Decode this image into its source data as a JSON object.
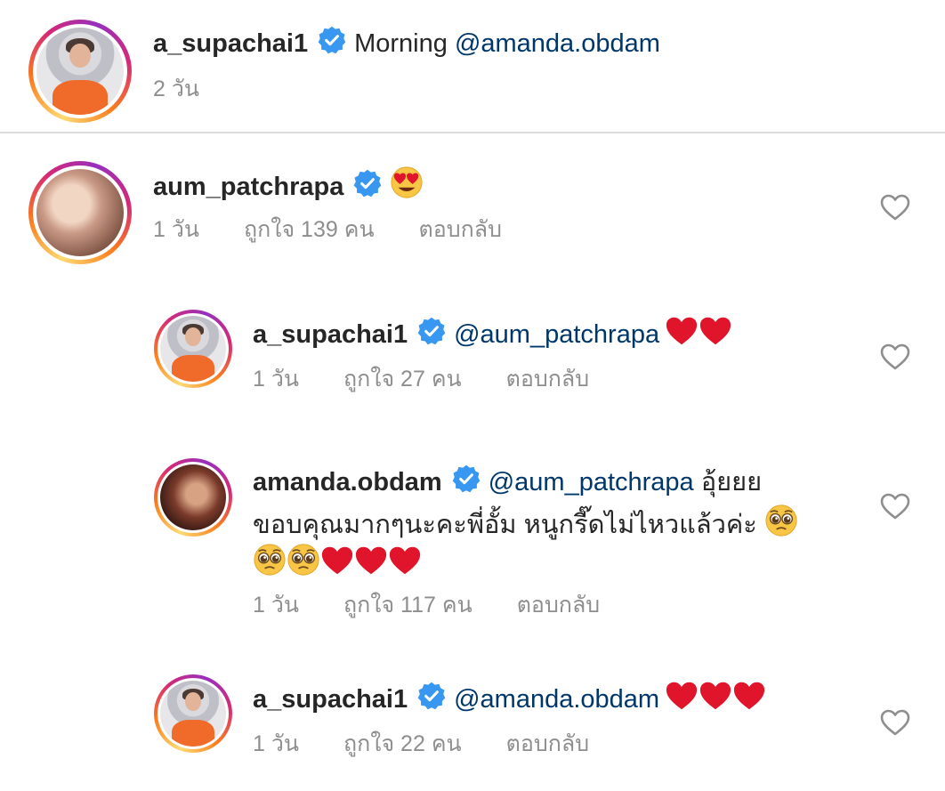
{
  "caption": {
    "username": "a_supachai1",
    "text": "Morning ",
    "mention": "@amanda.obdam",
    "time": "2 วัน"
  },
  "comments": [
    {
      "username": "aum_patchrapa",
      "emoji": "heart-eyes",
      "time": "1 วัน",
      "likes": "ถูกใจ 139 คน",
      "reply": "ตอบกลับ"
    },
    {
      "username": "a_supachai1",
      "mention": "@aum_patchrapa",
      "hearts": 2,
      "time": "1 วัน",
      "likes": "ถูกใจ 27 คน",
      "reply": "ตอบกลับ"
    },
    {
      "username": "amanda.obdam",
      "mention": "@aum_patchrapa",
      "text1": " อุ้ยยย",
      "line2": "ขอบคุณมากๆนะคะพี่อั้ม หนูกรี๊ดไม่ไหวแล้วค่ะ",
      "pleading_line2": 1,
      "pleading_line3": 2,
      "hearts_line3": 3,
      "time": "1 วัน",
      "likes": "ถูกใจ 117 คน",
      "reply": "ตอบกลับ"
    },
    {
      "username": "a_supachai1",
      "mention": "@amanda.obdam",
      "hearts": 3,
      "time": "1 วัน",
      "likes": "ถูกใจ 22 คน",
      "reply": "ตอบกลับ"
    }
  ],
  "colors": {
    "verified": "#3897f0",
    "mention": "#00376b",
    "meta": "#8e8e8e",
    "heart": "#e0142a",
    "divider": "#dbdbdb"
  },
  "icons": [
    "verified-badge-icon",
    "like-heart-icon",
    "heart-emoji",
    "pleading-face-emoji",
    "heart-eyes-emoji"
  ]
}
